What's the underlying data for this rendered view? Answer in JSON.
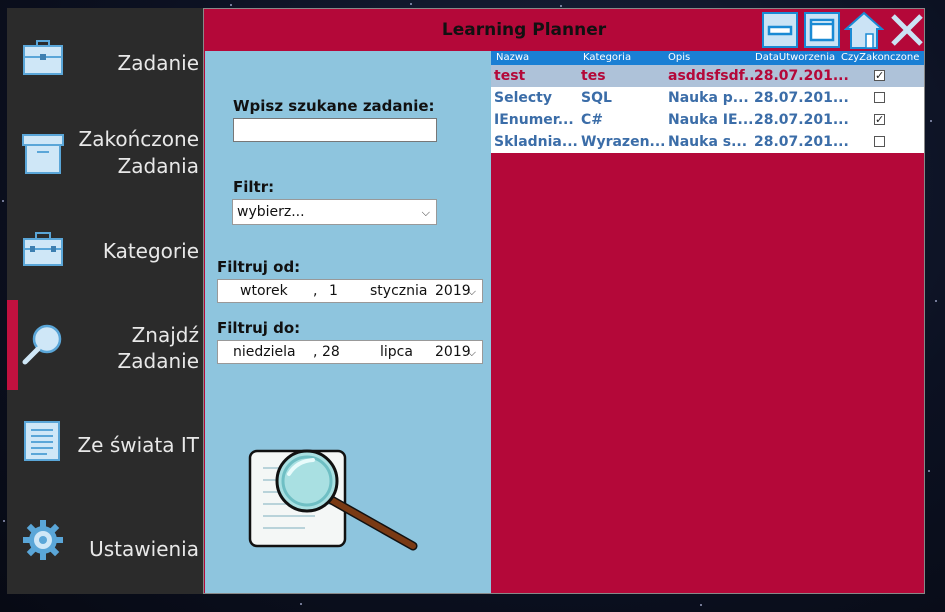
{
  "app": {
    "title": "Learning Planner"
  },
  "sidebar": {
    "items": [
      {
        "label_1": "Zadanie",
        "label_2": "",
        "icon": "briefcase-icon"
      },
      {
        "label_1": "Zakończone",
        "label_2": "Zadania",
        "icon": "archive-box-icon"
      },
      {
        "label_1": "Kategorie",
        "label_2": "",
        "icon": "toolbox-icon"
      },
      {
        "label_1": "Znajdź",
        "label_2": "Zadanie",
        "icon": "magnifier-icon",
        "active": true
      },
      {
        "label_1": "Ze świata IT",
        "label_2": "",
        "icon": "newspaper-icon"
      },
      {
        "label_1": "Ustawienia",
        "label_2": "",
        "icon": "gear-icon"
      }
    ]
  },
  "filters": {
    "search_label": "Wpisz szukane zadanie:",
    "search_value": "",
    "filter_label": "Filtr:",
    "filter_value": "wybierz...",
    "from_label": "Filtruj od:",
    "from": {
      "weekday": "wtorek",
      "sep": ",",
      "day": "1",
      "month": "stycznia",
      "year": "2019"
    },
    "to_label": "Filtruj do:",
    "to": {
      "weekday": "niedziela",
      "sep": ",",
      "day": "28",
      "month": "lipca",
      "year": "2019"
    }
  },
  "grid": {
    "headers": [
      "Nazwa",
      "Kategoria",
      "Opis",
      "DataUtworzenia",
      "CzyZakonczone"
    ],
    "rows": [
      {
        "nazwa": "test",
        "kategoria": "tes",
        "opis": "asddsfsdf...",
        "data": "28.07.201...",
        "done": true,
        "selected": true
      },
      {
        "nazwa": "Selecty",
        "kategoria": "SQL",
        "opis": "Nauka p...",
        "data": "28.07.201...",
        "done": false
      },
      {
        "nazwa": "IEnumer...",
        "kategoria": "C#",
        "opis": "Nauka IE...",
        "data": "28.07.201...",
        "done": true
      },
      {
        "nazwa": "Skladnia...",
        "kategoria": "Wyrazen...",
        "opis": "Nauka s...",
        "data": "28.07.201...",
        "done": false
      }
    ]
  },
  "colors": {
    "accent": "#b40839",
    "panel": "#8ec5de",
    "header": "#1a7fd4",
    "sidebar": "#2b2b2b"
  }
}
